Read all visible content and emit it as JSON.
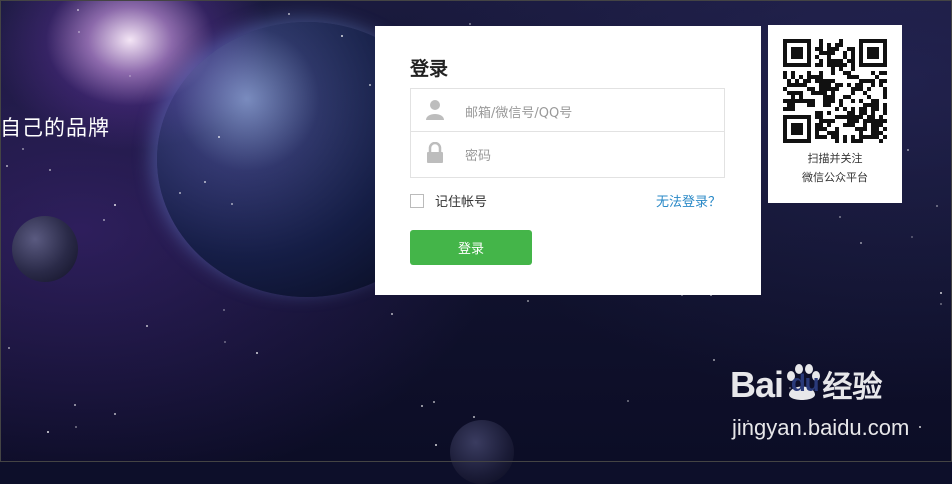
{
  "background": {
    "slogan": "自己的品牌"
  },
  "login": {
    "title": "登录",
    "username_placeholder": "邮箱/微信号/QQ号",
    "password_placeholder": "密码",
    "remember_label": "记住帐号",
    "forgot_link": "无法登录？",
    "submit_label": "登录",
    "button_color": "#44b549",
    "link_color": "#2a89c7"
  },
  "qr": {
    "caption_line1": "扫描并关注",
    "caption_line2": "微信公众平台"
  },
  "watermark": {
    "logo_text": "Bai",
    "logo_du": "du",
    "logo_cn": "经验",
    "url": "jingyan.baidu.com"
  }
}
